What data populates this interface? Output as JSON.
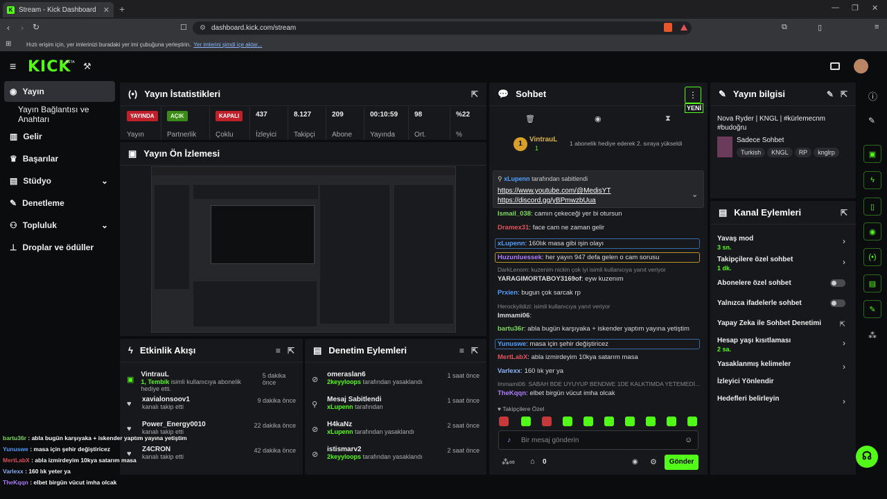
{
  "browser": {
    "tab_title": "Stream - Kick Dashboard",
    "url": "dashboard.kick.com/stream",
    "bookmark_hint": "Hızlı erişim için, yer imlerinizi buradaki yer imi çubuğuna yerleştirin.",
    "bookmark_link": "Yer imlerini şimdi içe aktar..."
  },
  "logo": "KICK",
  "logo_beta": "BETA",
  "sidebar": {
    "items": [
      {
        "label": "Yayın"
      },
      {
        "label": "Yayın Bağlantısı ve Anahtarı"
      },
      {
        "label": "Gelir"
      },
      {
        "label": "Başarılar"
      },
      {
        "label": "Stüdyo"
      },
      {
        "label": "Denetleme"
      },
      {
        "label": "Topluluk"
      },
      {
        "label": "Droplar ve ödüller"
      }
    ]
  },
  "stats": {
    "title": "Yayın İstatistikleri",
    "items": [
      {
        "badge": "YAYINDA",
        "label": "Yayın"
      },
      {
        "badge": "AÇIK",
        "label": "Partnerlik"
      },
      {
        "badge": "KAPALI",
        "label": "Çoklu"
      },
      {
        "value": "437",
        "label": "İzleyici"
      },
      {
        "value": "8.127",
        "label": "Takipçi"
      },
      {
        "value": "209",
        "label": "Abone"
      },
      {
        "value": "00:10:59",
        "label": "Yayında"
      },
      {
        "value": "98",
        "label": "Ort."
      },
      {
        "value": "%22",
        "label": "%"
      }
    ]
  },
  "preview": {
    "title": "Yayın Ön İzlemesi"
  },
  "activity": {
    "title": "Etkinlik Akışı",
    "items": [
      {
        "name": "VintrauL",
        "sub_em": "1, Tembik",
        "sub": " isimli kullanıcıya abonelik hediye etti.",
        "time": "5 dakika önce"
      },
      {
        "name": "xavialonsoov1",
        "sub": "kanalı takip etti",
        "time": "9 dakika önce"
      },
      {
        "name": "Power_Energy0010",
        "sub": "kanalı takip etti",
        "time": "22 dakika önce"
      },
      {
        "name": "Z4CRON",
        "sub": "kanalı takip etti",
        "time": "42 dakika önce"
      }
    ]
  },
  "moderation": {
    "title": "Denetim Eylemleri",
    "items": [
      {
        "name": "omeraslan6",
        "sub_em": "2keyyloops",
        "sub": " tarafından yasaklandı",
        "time": "1 saat önce"
      },
      {
        "name": "Mesaj Sabitlendi",
        "sub_em": "xLupenn",
        "sub": " tarafından",
        "time": "1 saat önce"
      },
      {
        "name": "H4kaNz",
        "sub_em": "xLupenn",
        "sub": " tarafından yasaklandı",
        "time": "2 saat önce"
      },
      {
        "name": "istismarv2",
        "sub_em": "2keyyloops",
        "sub": " tarafından yasaklandı",
        "time": "2 saat önce"
      }
    ]
  },
  "chat": {
    "title": "Sohbet",
    "new_badge": "YENİ",
    "gift_user": "VintrauL",
    "gift_count": "1",
    "gift_text": "1 abonelik hediye ederek 2. sıraya yükseldi",
    "pinned_by": "xLupenn",
    "pinned_by_suffix": "tarafından sabitlendi",
    "pinned_link1": "https://www.youtube.com/@MedisYT",
    "pinned_link2": "https://discord.gg/yBPmwzbUua",
    "messages": [
      {
        "user": "Ismail_038",
        "text": "camın çekeceği yer bi otursun",
        "color": "#7ddc5c"
      },
      {
        "user": "Dramex31",
        "text": "face cam ne zaman gelir",
        "color": "#e0525c"
      },
      {
        "user": "xLupenn",
        "text": "160lık masa gibi işin olayı",
        "color": "#4ea0ff"
      },
      {
        "user": "Huzunluessek",
        "text": "her yayın 947 defa gelen o cam sorusu",
        "color": "#b07cff"
      },
      {
        "system": "DarkLenom: kuzenim nickin çok iyi isimli kullanıcıya yanıt veriyor"
      },
      {
        "user": "YARAGIMORTABOY3169of",
        "text": "eyw kuzenım",
        "color": "#ddd"
      },
      {
        "user": "Prxien",
        "text": "bugun çok sarcak rp",
        "color": "#4ea0ff"
      },
      {
        "system": "Herockyildizi: isimli kullanıcıya yanıt veriyor"
      },
      {
        "user": "Immami06",
        "text": "",
        "color": "#ddd"
      },
      {
        "user": "bartu36r",
        "text": "abla bugün karşıyaka + iskender yaptım yayına yetiştim",
        "color": "#7ddc5c"
      },
      {
        "user": "Yunuswe",
        "text": "masa için şehir değiştiricez",
        "color": "#4ea0ff"
      },
      {
        "user": "MertLabX",
        "text": "abla izmirdeyim 10kya satarım masa",
        "color": "#e0525c"
      },
      {
        "user": "Varlexx",
        "text": "160 lık yer ya",
        "color": "#8ab4f8"
      },
      {
        "system": "Immami06: SABAH BDE UYUYUP BENDWE 1DE KALKTIMDA YETEMEDİ..."
      },
      {
        "user": "TheKqqn",
        "text": "elbet birgün vücut imha olcak",
        "color": "#b07cff"
      }
    ],
    "followers_only": "Takipçilere Özel",
    "input_placeholder": "Bir mesaj gönderin",
    "points": "0",
    "send": "Gönder"
  },
  "stream_info": {
    "title": "Yayın bilgisi",
    "stream_title": "Nova Ryder | KNGL | #kürlemecnm #budoğru",
    "category": "Sadece Sohbet",
    "tags": [
      "Turkish",
      "KNGL",
      "RP",
      "knglrp"
    ]
  },
  "channel_actions": {
    "title": "Kanal Eylemleri",
    "items": [
      {
        "label": "Yavaş mod",
        "sub": "3 sn."
      },
      {
        "label": "Takipçilere özel sohbet",
        "sub": "1 dk."
      },
      {
        "label": "Abonelere özel sohbet"
      },
      {
        "label": "Yalnızca ifadelerle sohbet"
      },
      {
        "label": "Yapay Zeka ile Sohbet Denetimi"
      },
      {
        "label": "Hesap yaşı kısıtlaması",
        "sub": "2 sa."
      },
      {
        "label": "Yasaklanmış kelimeler"
      },
      {
        "label": "İzleyici Yönlendir"
      },
      {
        "label": "Hedefleri belirleyin"
      }
    ]
  },
  "overlay": [
    {
      "user": "bartu36r",
      "text": " : abla bugün karşıyaka + iskender yaptım yayına yetiştim",
      "color": "#7ddc5c"
    },
    {
      "user": "Yunuswe",
      "text": " : masa için şehir değiştiricez",
      "color": "#4ea0ff"
    },
    {
      "user": "MertLabX",
      "text": " : abla izmirdeyim 10kya satarım masa",
      "color": "#e0525c"
    },
    {
      "user": "Varlexx",
      "text": " : 160 lık yeter ya",
      "color": "#8ab4f8"
    },
    {
      "user": "TheKqqn",
      "text": " : elbet birgün vücut imha olcak",
      "color": "#b07cff"
    }
  ]
}
